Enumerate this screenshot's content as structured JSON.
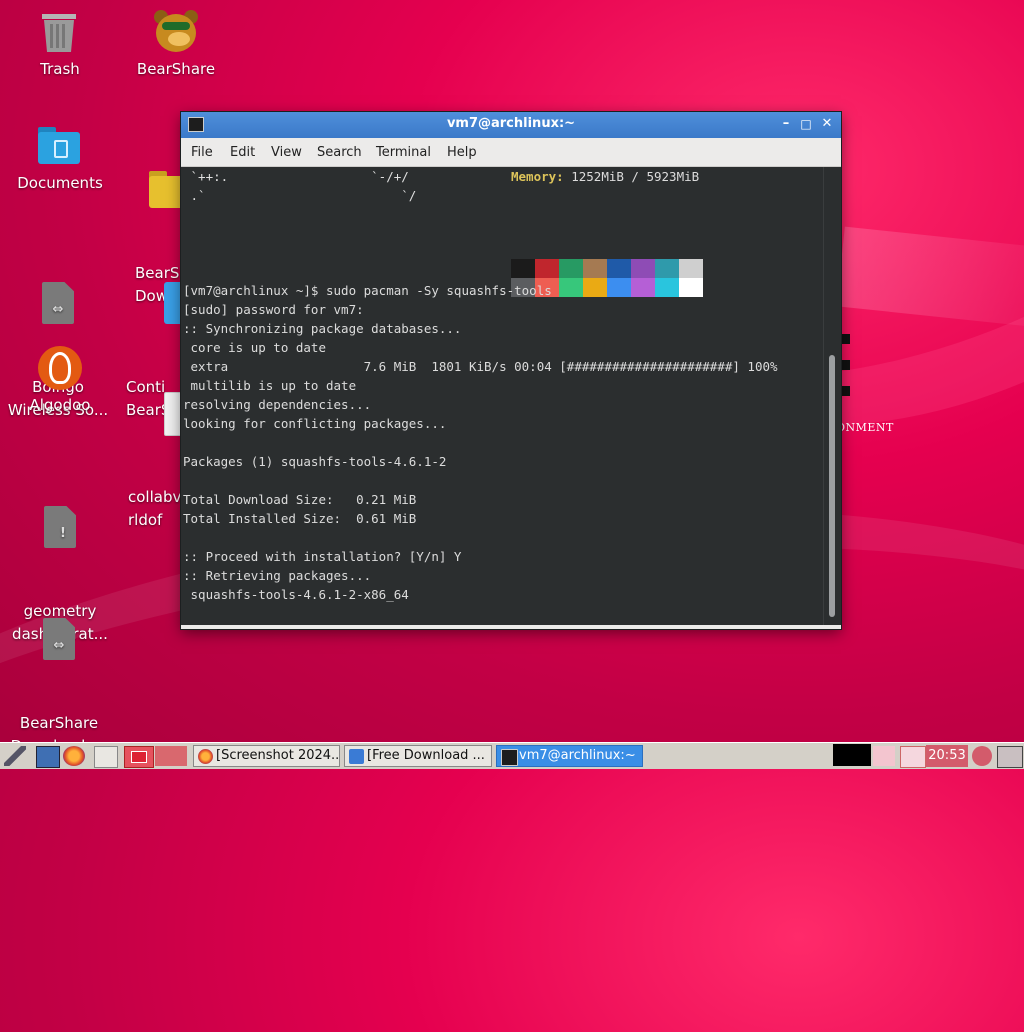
{
  "desktop": {
    "icons": [
      {
        "label": "Trash",
        "icon": "trash-icon"
      },
      {
        "label": "BearShare",
        "icon": "bearshare-icon"
      },
      {
        "label": "Documents",
        "icon": "folder-icon"
      },
      {
        "label": "BearS\nDown",
        "icon": "bearshare-folder-icon"
      },
      {
        "label": "Boingo\nWireless So...",
        "icon": "file-icon"
      },
      {
        "label": "Conti\nBearSh",
        "icon": "web-file-icon"
      },
      {
        "label": "Algodoo",
        "icon": "algodoo-icon"
      },
      {
        "label": "collabv\nrldof",
        "icon": "text-file-icon"
      },
      {
        "label": "geometry\ndash (pirat...",
        "icon": "file-icon"
      },
      {
        "label": "BearShare\nDownloads...",
        "icon": "file-icon"
      }
    ],
    "background_text": "ONMENT"
  },
  "window": {
    "title": "vm7@archlinux:~",
    "buttons": {
      "minimize": "–",
      "maximize": "□",
      "close": "✕"
    },
    "menu": [
      "File",
      "Edit",
      "View",
      "Search",
      "Terminal",
      "Help"
    ]
  },
  "terminal": {
    "neofetch": {
      "art1": " `++:.                   `-/+/",
      "art2": " .`                          `/",
      "memory_label": "Memory:",
      "memory_value": " 1252MiB / 5923MiB"
    },
    "swatch_colors_top": [
      "#1b1b1b",
      "#c0262d",
      "#279a63",
      "#a57a52",
      "#1f5aa8",
      "#8e4cb5",
      "#2f9aab",
      "#cfcfcf"
    ],
    "swatch_colors_bottom": [
      "#5b5d60",
      "#ee5e52",
      "#37c77b",
      "#eaaa14",
      "#3c8ef0",
      "#b55fd6",
      "#29c5de",
      "#ffffff"
    ],
    "lines": [
      "[vm7@archlinux ~]$ sudo pacman -Sy squashfs-tools",
      "[sudo] password for vm7:",
      ":: Synchronizing package databases...",
      " core is up to date",
      " extra                  7.6 MiB  1801 KiB/s 00:04 [######################] 100%",
      " multilib is up to date",
      "resolving dependencies...",
      "looking for conflicting packages...",
      "",
      "Packages (1) squashfs-tools-4.6.1-2",
      "",
      "Total Download Size:   0.21 MiB",
      "Total Installed Size:  0.61 MiB",
      "",
      ":: Proceed with installation? [Y/n] Y",
      ":: Retrieving packages...",
      " squashfs-tools-4.6.1-2-x86_64"
    ]
  },
  "taskbar": {
    "tasks": [
      {
        "label": "[Screenshot 2024...",
        "icon": "firefox-icon"
      },
      {
        "label": "[Free Download ...",
        "icon": "app-icon"
      },
      {
        "label": "vm7@archlinux:~",
        "icon": "terminal-icon"
      }
    ],
    "clock": "20:53"
  }
}
